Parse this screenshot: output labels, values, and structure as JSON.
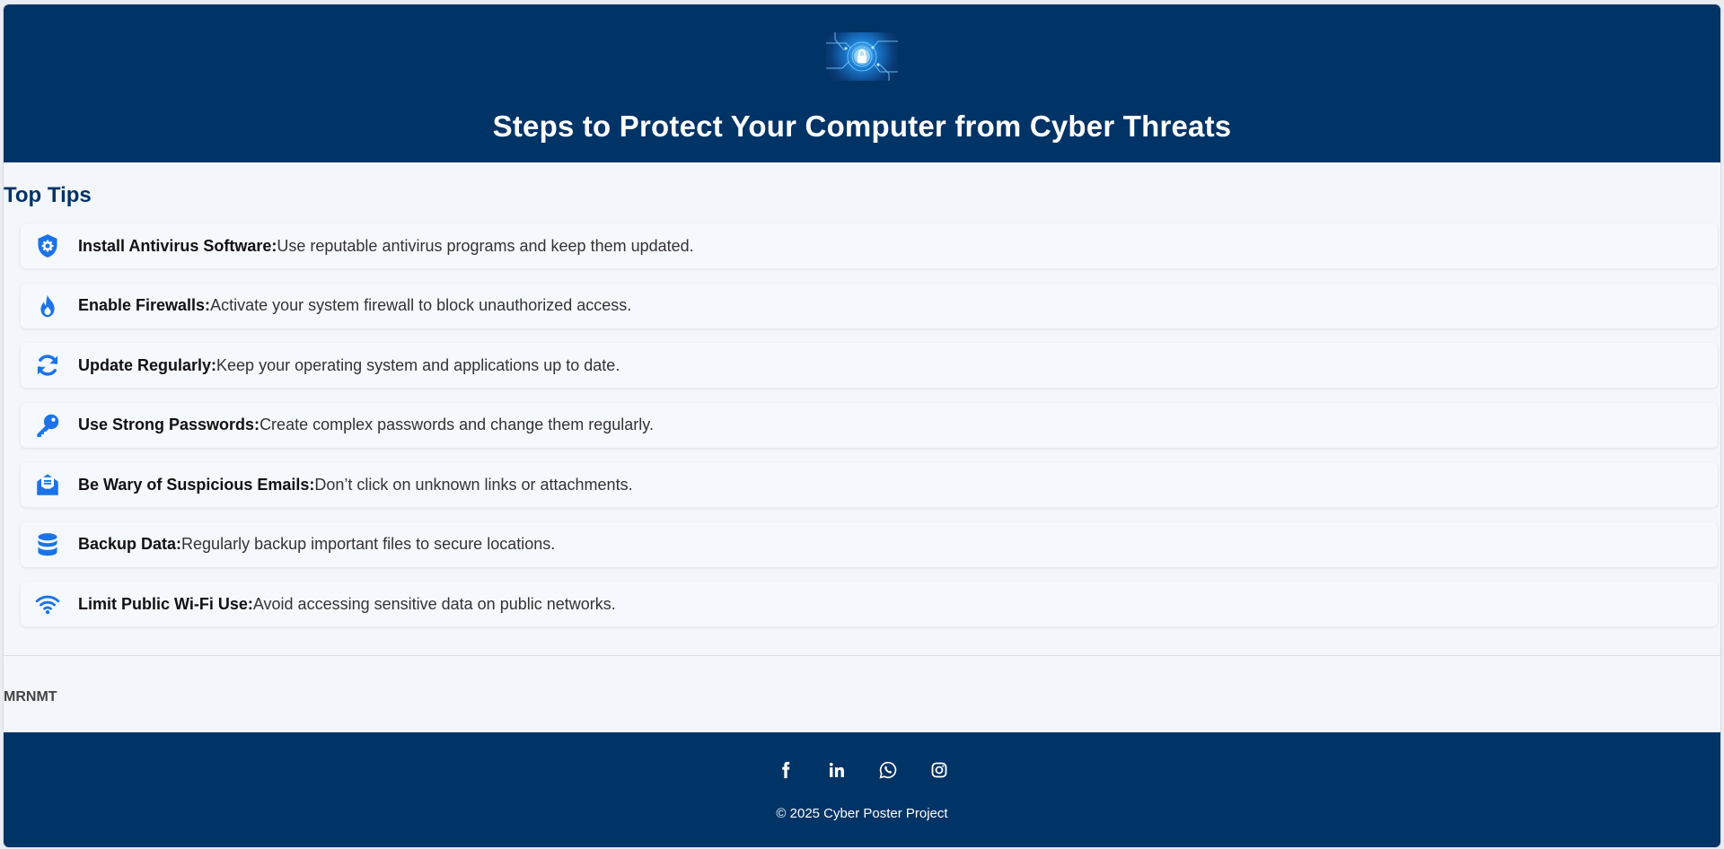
{
  "header": {
    "title": "Steps to Protect Your Computer from Cyber Threats"
  },
  "tips_section": {
    "heading": "Top Tips",
    "items": [
      {
        "icon": "shield-gear-icon",
        "title": "Install Antivirus Software:",
        "text": "Use reputable antivirus programs and keep them updated."
      },
      {
        "icon": "fire-icon",
        "title": "Enable Firewalls:",
        "text": "Activate your system firewall to block unauthorized access."
      },
      {
        "icon": "sync-icon",
        "title": "Update Regularly:",
        "text": "Keep your operating system and applications up to date."
      },
      {
        "icon": "key-icon",
        "title": "Use Strong Passwords:",
        "text": "Create complex passwords and change them regularly."
      },
      {
        "icon": "envelope-open-icon",
        "title": "Be Wary of Suspicious Emails:",
        "text": "Don’t click on unknown links or attachments."
      },
      {
        "icon": "database-icon",
        "title": "Backup Data:",
        "text": "Regularly backup important files to secure locations."
      },
      {
        "icon": "wifi-icon",
        "title": "Limit Public Wi-Fi Use:",
        "text": "Avoid accessing sensitive data on public networks."
      }
    ]
  },
  "author": "MRNMT",
  "footer": {
    "socials": [
      "facebook-icon",
      "linkedin-icon",
      "whatsapp-icon",
      "instagram-icon"
    ],
    "copyright": "© 2025 Cyber Poster Project"
  },
  "colors": {
    "primary": "#003366",
    "icon": "#1a73e8",
    "background": "#f3f7fb"
  }
}
